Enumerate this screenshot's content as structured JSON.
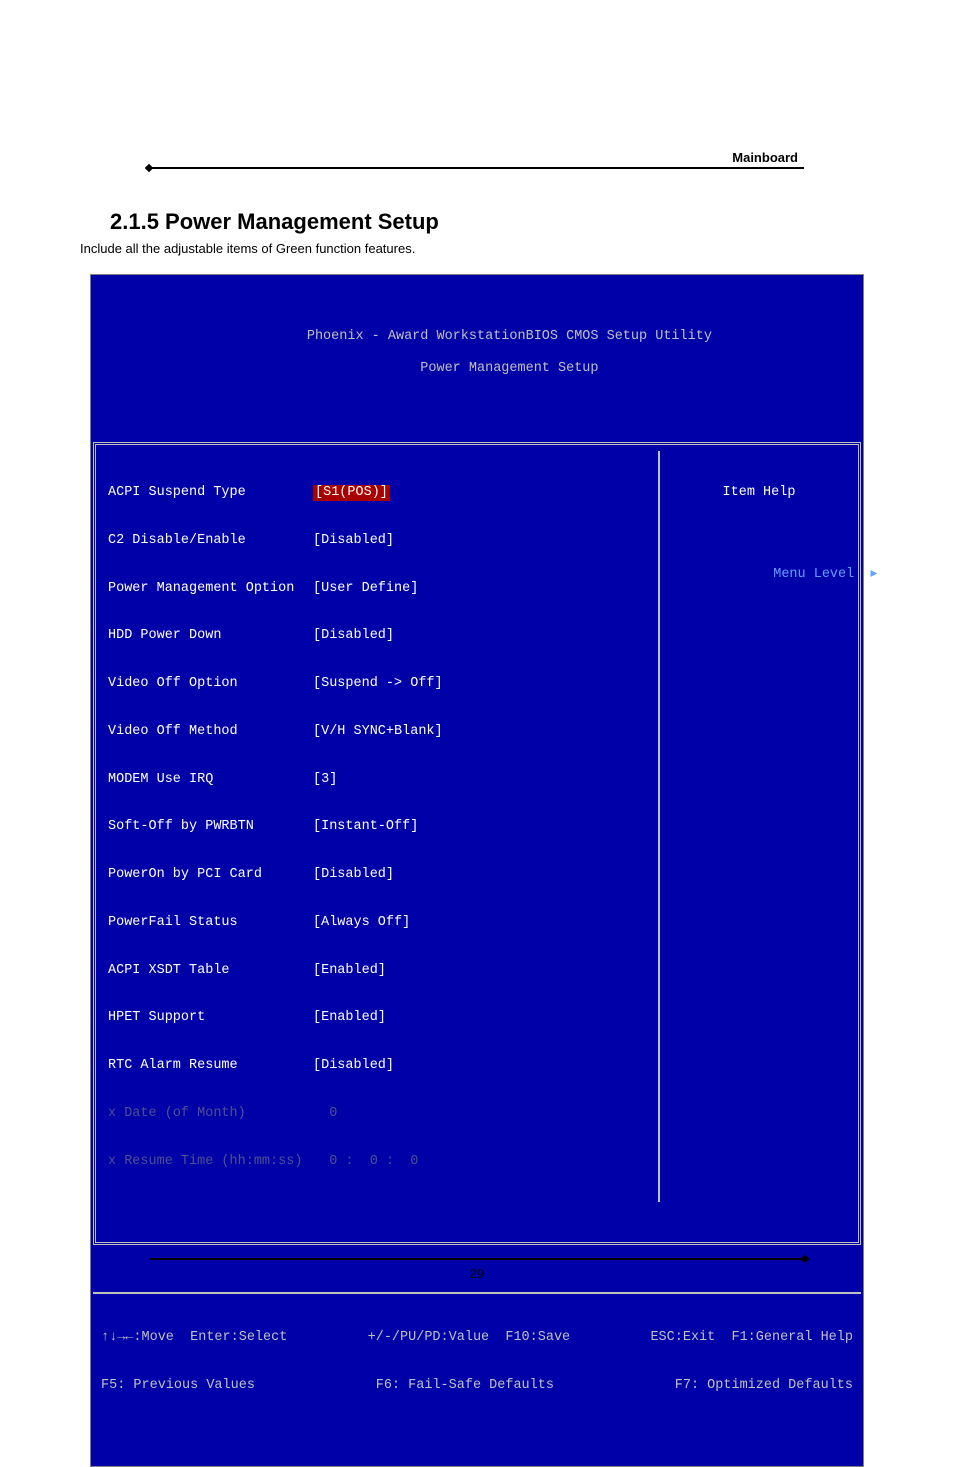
{
  "header": {
    "label": "Mainboard"
  },
  "section": {
    "title": "2.1.5 Power Management Setup",
    "subtitle": "Include all the adjustable items of Green function features."
  },
  "bios": {
    "title_line1": "Phoenix - Award WorkstationBIOS CMOS Setup Utility",
    "title_line2": "Power Management Setup",
    "help_title": "Item Help",
    "menu_level_label": "Menu Level",
    "menu_level_arrow": "▸",
    "items": [
      {
        "label": "ACPI Suspend Type",
        "value": "[S1(POS)]",
        "highlight": true
      },
      {
        "label": "C2 Disable/Enable",
        "value": "[Disabled]"
      },
      {
        "label": "Power Management Option",
        "value": "[User Define]"
      },
      {
        "label": "HDD Power Down",
        "value": "[Disabled]"
      },
      {
        "label": "Video Off Option",
        "value": "[Suspend -> Off]"
      },
      {
        "label": "Video Off Method",
        "value": "[V/H SYNC+Blank]"
      },
      {
        "label": "MODEM Use IRQ",
        "value": "[3]"
      },
      {
        "label": "Soft-Off by PWRBTN",
        "value": "[Instant-Off]"
      },
      {
        "label": "PowerOn by PCI Card",
        "value": "[Disabled]"
      },
      {
        "label": "PowerFail Status",
        "value": "[Always Off]"
      },
      {
        "label": "ACPI XSDT Table",
        "value": "[Enabled]"
      },
      {
        "label": "HPET Support",
        "value": "[Enabled]"
      },
      {
        "label": "RTC Alarm Resume",
        "value": "[Disabled]"
      },
      {
        "label": "x Date (of Month)",
        "value": "  0",
        "dim": true
      },
      {
        "label": "x Resume Time (hh:mm:ss)",
        "value": "  0 :  0 :  0",
        "dim": true
      }
    ],
    "footer": {
      "row1_left": "↑↓→←:Move  Enter:Select",
      "row1_mid": "+/-/PU/PD:Value  F10:Save",
      "row1_right": "ESC:Exit  F1:General Help",
      "row2_left": "F5: Previous Values",
      "row2_mid": "F6: Fail-Safe Defaults",
      "row2_right": "F7: Optimized Defaults"
    }
  },
  "page_number": "29"
}
